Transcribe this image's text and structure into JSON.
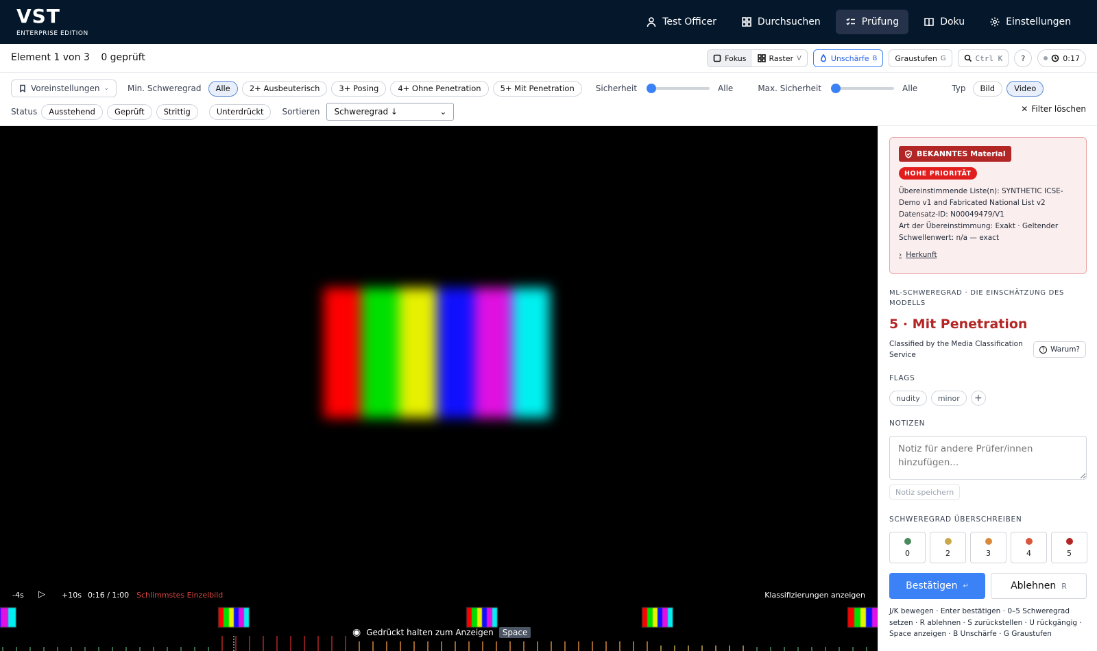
{
  "app": {
    "name": "VST",
    "edition": "ENTERPRISE EDITION"
  },
  "nav": [
    {
      "label": "Test Officer",
      "icon": "user-icon"
    },
    {
      "label": "Durchsuchen",
      "icon": "grid-icon"
    },
    {
      "label": "Prüfung",
      "icon": "checklist-icon",
      "active": true
    },
    {
      "label": "Doku",
      "icon": "book-icon"
    },
    {
      "label": "Einstellungen",
      "icon": "gear-icon"
    }
  ],
  "subbar": {
    "position": "Element 1 von 3",
    "reviewed": "0 geprüft",
    "focus_label": "Fokus",
    "grid_label": "Raster",
    "grid_key": "V",
    "blur_label": "Unschärfe",
    "blur_key": "B",
    "gray_label": "Graustufen",
    "gray_key": "G",
    "search_shortcut": "Ctrl K",
    "help_label": "?",
    "timer": "0:17"
  },
  "filters": {
    "presets_label": "Voreinstellungen",
    "min_severity_label": "Min. Schweregrad",
    "severity_chips": [
      "Alle",
      "2+ Ausbeuterisch",
      "3+ Posing",
      "4+ Ohne Penetration",
      "5+ Mit Penetration"
    ],
    "severity_selected": "Alle",
    "confidence_label": "Sicherheit",
    "confidence_value": "Alle",
    "max_confidence_label": "Max. Sicherheit",
    "max_confidence_value": "Alle",
    "type_label": "Typ",
    "type_options": [
      "Bild",
      "Video"
    ],
    "type_selected": "Video",
    "status_label": "Status",
    "status_chips": [
      "Ausstehend",
      "Geprüft",
      "Strittig"
    ],
    "suppressed_label": "Unterdrückt",
    "sort_label": "Sortieren",
    "sort_value": "Schweregrad ↓",
    "clear_label": "Filter löschen"
  },
  "player": {
    "back_label": "-4s",
    "fwd_label": "+10s",
    "time": "0:16 / 1:00",
    "worst_frame_label": "Schlimmstes Einzelbild",
    "show_classifications_label": "Klassifizierungen anzeigen",
    "hold_label": "Gedrückt halten zum Anzeigen",
    "hold_key": "Space",
    "colors": {
      "red": "#ff0000",
      "green": "#00e000",
      "yellow": "#e6f000",
      "blue": "#1010ff",
      "magenta": "#e010e0",
      "cyan": "#00f0f0"
    }
  },
  "panel": {
    "known_badge": "BEKANNTES Material",
    "priority_badge": "HOHE PRIORITÄT",
    "match_lines": [
      "Übereinstimmende Liste(n): SYNTHETIC ICSE-Demo v1 and Fabricated National List v2",
      "Datensatz-ID: N00049479/V1",
      "Art der Übereinstimmung: Exakt · Geltender Schwellenwert: n/a — exact"
    ],
    "provenance_label": "Herkunft",
    "ml_section": "ML-SCHWEREGRAD · DIE EINSCHÄTZUNG DES MODELLS",
    "ml_value": "5 · Mit Penetration",
    "ml_source": "Classified by the Media Classification Service",
    "why_label": "Warum?",
    "flags_section": "FLAGS",
    "flags": [
      "nudity",
      "minor"
    ],
    "add_flag": "+",
    "notes_section": "NOTIZEN",
    "notes_placeholder": "Notiz für andere Prüfer/innen hinzufügen...",
    "save_note_label": "Notiz speichern",
    "override_section": "SCHWEREGRAD ÜBERSCHREIBEN",
    "severity_levels": [
      {
        "value": "0",
        "color": "#4a8a5c"
      },
      {
        "value": "2",
        "color": "#c9a94a"
      },
      {
        "value": "3",
        "color": "#d9893a"
      },
      {
        "value": "4",
        "color": "#d9563a"
      },
      {
        "value": "5",
        "color": "#b32626"
      }
    ],
    "confirm_label": "Bestätigen",
    "confirm_key": "↵",
    "reject_label": "Ablehnen",
    "reject_key": "R",
    "shortcuts": "J/K bewegen · Enter bestätigen · 0–5 Schweregrad setzen · R ablehnen · S zurückstellen · U rückgängig · Space anzeigen · B Unschärfe · G Graustufen"
  }
}
